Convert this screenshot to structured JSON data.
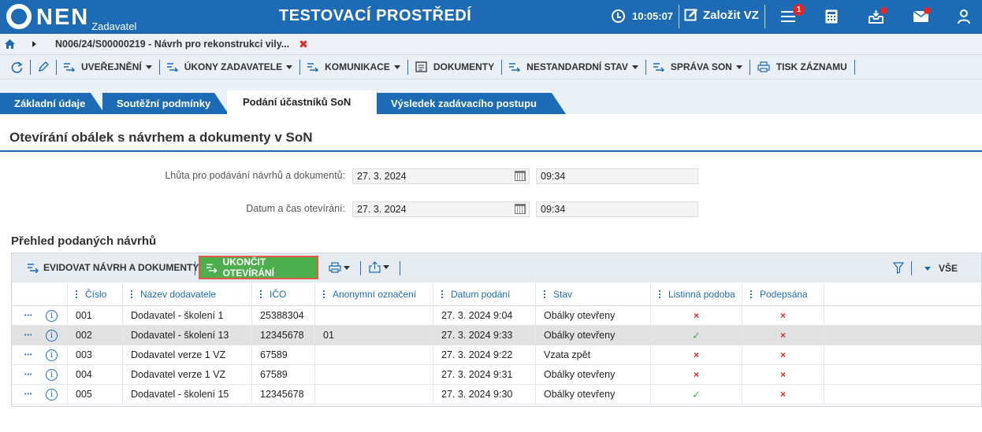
{
  "colors": {
    "brand": "#1d6bb5",
    "success": "#4cae4c",
    "danger": "#e02a2a",
    "highlight_border": "#e05a47"
  },
  "header": {
    "logo": "NEN",
    "logo_sub": "Zadavatel",
    "environment": "TESTOVACÍ PROSTŘEDÍ",
    "time": "10:05:07",
    "create_label": "Založit VZ",
    "notification_count": "1",
    "icons": [
      "clock-icon",
      "edit-icon",
      "menu-icon",
      "calculator-icon",
      "inbox-icon",
      "mail-icon",
      "user-icon"
    ]
  },
  "breadcrumb": {
    "path": "N006/24/S00000219 - Návrh pro rekonstrukci vily..."
  },
  "toolbar": {
    "items": [
      {
        "label": "UVEŘEJNĚNÍ",
        "dropdown": true
      },
      {
        "label": "ÚKONY ZADAVATELE",
        "dropdown": true
      },
      {
        "label": "KOMUNIKACE",
        "dropdown": true
      },
      {
        "label": "DOKUMENTY",
        "dropdown": false
      },
      {
        "label": "NESTANDARDNÍ STAV",
        "dropdown": true
      },
      {
        "label": "SPRÁVA SON",
        "dropdown": true
      },
      {
        "label": "TISK ZÁZNAMU",
        "dropdown": false
      }
    ]
  },
  "tabs": [
    {
      "label": "Základní údaje",
      "active": false
    },
    {
      "label": "Soutěžní podmínky",
      "active": false
    },
    {
      "label": "Podání účastníků SoN",
      "active": true
    },
    {
      "label": "Výsledek zadávacího postupu",
      "active": false
    }
  ],
  "section": {
    "title": "Otevírání obálek s návrhem a dokumenty v SoN"
  },
  "form": {
    "deadline_label": "Lhůta pro podávání návrhů a dokumentů:",
    "deadline_date": "27. 3. 2024",
    "deadline_time": "09:34",
    "opening_label": "Datum a čas otevírání:",
    "opening_date": "27. 3. 2024",
    "opening_time": "09:34"
  },
  "grid": {
    "title": "Přehled podaných návrhů",
    "evidovat_label": "EVIDOVAT NÁVRH A DOKUMENTY",
    "ukoncit_label": "UKONČIT OTEVÍRÁNÍ",
    "filter_label": "VŠE",
    "columns": [
      "Číslo",
      "Název dodavatele",
      "IČO",
      "Anonymní označení",
      "Datum podání",
      "Stav",
      "Listinná podoba",
      "Podepsána"
    ],
    "rows": [
      {
        "cislo": "001",
        "nazev": "Dodavatel - školení 1",
        "ico": "25388304",
        "anon": "",
        "datum": "27. 3. 2024 9:04",
        "stav": "Obálky otevřeny",
        "listinna": "×",
        "podepsana": "×",
        "selected": false
      },
      {
        "cislo": "002",
        "nazev": "Dodavatel - školení 13",
        "ico": "12345678",
        "anon": "01",
        "datum": "27. 3. 2024 9:33",
        "stav": "Obálky otevřeny",
        "listinna": "✓",
        "podepsana": "×",
        "selected": true
      },
      {
        "cislo": "003",
        "nazev": "Dodavatel verze 1 VZ",
        "ico": "67589",
        "anon": "",
        "datum": "27. 3. 2024 9:22",
        "stav": "Vzata zpět",
        "listinna": "×",
        "podepsana": "×",
        "selected": false
      },
      {
        "cislo": "004",
        "nazev": "Dodavatel verze 1 VZ",
        "ico": "67589",
        "anon": "",
        "datum": "27. 3. 2024 9:31",
        "stav": "Obálky otevřeny",
        "listinna": "×",
        "podepsana": "×",
        "selected": false
      },
      {
        "cislo": "005",
        "nazev": "Dodavatel - školení 15",
        "ico": "12345678",
        "anon": "",
        "datum": "27. 3. 2024 9:30",
        "stav": "Obálky otevřeny",
        "listinna": "✓",
        "podepsana": "×",
        "selected": false
      }
    ]
  }
}
